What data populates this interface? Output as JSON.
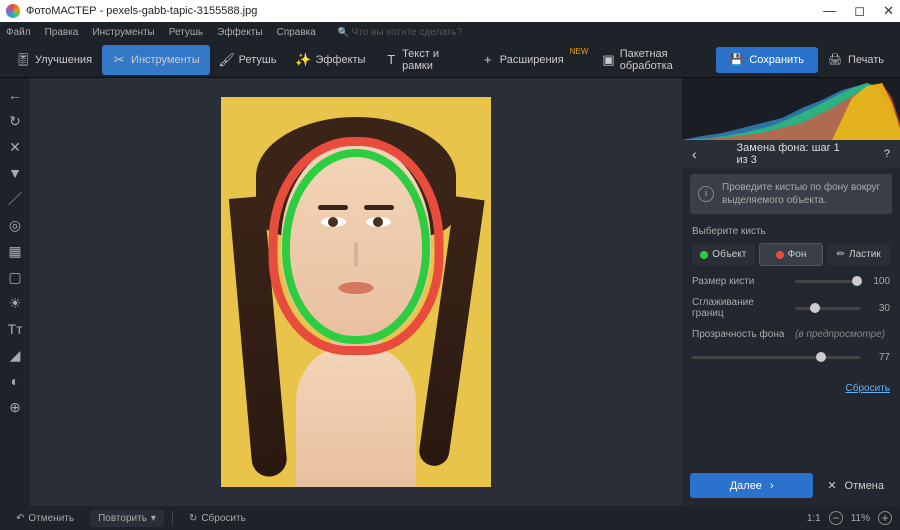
{
  "titlebar": {
    "app": "ФотоМАСТЕР",
    "file": "pexels-gabb-tapic-3155588.jpg"
  },
  "menu": {
    "items": [
      "Файл",
      "Правка",
      "Инструменты",
      "Ретушь",
      "Эффекты",
      "Справка"
    ],
    "search_placeholder": "Что вы хотите сделать?"
  },
  "toolbar": {
    "enhance": "Улучшения",
    "tools": "Инструменты",
    "retouch": "Ретушь",
    "effects": "Эффекты",
    "text": "Текст и рамки",
    "ext": "Расширения",
    "ext_badge": "NEW",
    "batch": "Пакетная обработка",
    "save": "Сохранить",
    "print": "Печать"
  },
  "panel": {
    "title": "Замена фона: шаг 1 из 3",
    "hint": "Проведите кистью по фону вокруг выделяемого объекта.",
    "brush_section": "Выберите кисть",
    "tabs": {
      "object": "Объект",
      "bg": "Фон",
      "eraser": "Ластик"
    },
    "size_label": "Размер кисти",
    "size_val": "100",
    "smooth_label": "Сглаживание границ",
    "smooth_val": "30",
    "opacity_label": "Прозрачность фона",
    "opacity_note": "(в предпросмотре)",
    "opacity_val": "77",
    "reset": "Сбросить",
    "next": "Далее",
    "cancel": "Отмена"
  },
  "bottom": {
    "undo": "Отменить",
    "redo": "Повторить",
    "reset": "Сбросить",
    "ratio": "1:1",
    "zoom": "11%"
  }
}
